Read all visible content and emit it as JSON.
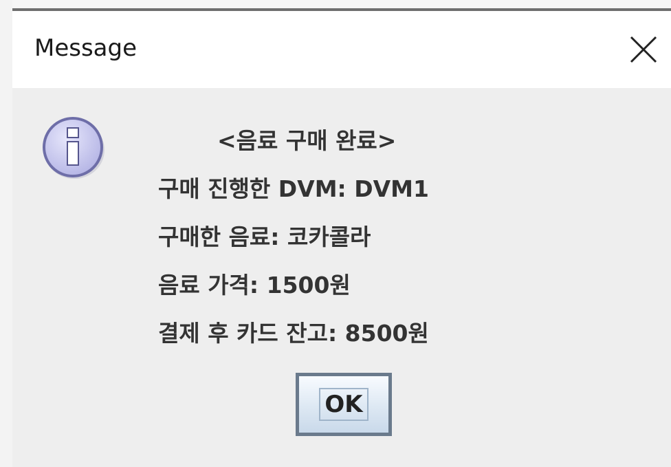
{
  "window": {
    "title": "Message",
    "close_glyph": "✕"
  },
  "dialog": {
    "icon": "info-icon",
    "lines": [
      "<음료 구매 완료>",
      "구매 진행한 DVM: DVM1",
      "구매한 음료: 코카콜라",
      "음료 가격: 1500원",
      "결제 후 카드 잔고: 8500원"
    ],
    "ok_label": "OK"
  },
  "colors": {
    "titlebar": "#ffffff",
    "body": "#eeeeee",
    "text": "#333333",
    "icon_fill": "#c8c8f0",
    "icon_border": "#6e6ea8",
    "button_border": "#6a7a8c"
  }
}
